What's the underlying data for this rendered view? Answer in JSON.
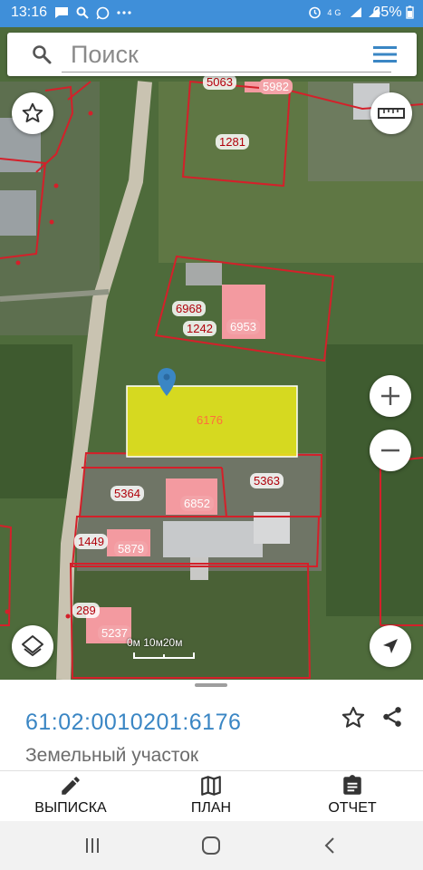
{
  "status_bar": {
    "time": "13:16",
    "notification_icons": [
      "message-icon",
      "search-icon",
      "whatsapp-icon",
      "more-icon"
    ],
    "network": "4G",
    "battery": "65%"
  },
  "search": {
    "placeholder": "Поиск"
  },
  "map": {
    "selected_parcel": "6176",
    "parcel_labels": [
      "5063",
      "5982",
      "1281",
      "6968",
      "1242",
      "6953",
      "5363",
      "5364",
      "6852",
      "1449",
      "5879",
      "289",
      "5237"
    ],
    "scale_text": "0м 10м20м",
    "colors": {
      "parcel_border": "#d4202a",
      "selected_fill": "#e6e61e",
      "building_fill": "#f39aa0"
    }
  },
  "sheet": {
    "cadastral_number": "61:02:0010201:6176",
    "object_type": "Земельный участок"
  },
  "actions": {
    "extract": "ВЫПИСКА",
    "plan": "ПЛАН",
    "report": "ОТЧЕТ"
  }
}
